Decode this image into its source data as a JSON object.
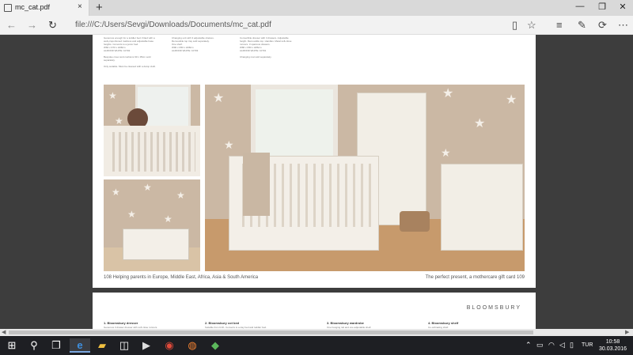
{
  "browser": {
    "tab_title": "mc_cat.pdf",
    "tab_close": "×",
    "new_tab": "+",
    "url": "file:///C:/Users/Sevgi/Downloads/Documents/mc_cat.pdf",
    "window": {
      "minimize": "—",
      "maximize": "❐",
      "close": "✕"
    }
  },
  "pdf": {
    "page1": {
      "col1_text": "Generous enough for a toddler bed. Fitted with a\nwell-proportioned mattress and adjustable base\nheights. Converts to a junior bed.\nW84 x D70 x H98cm\nALMOND WHITE: 10702\n\nBespoke cover and cushions 90 x 35cm sold\nseparately.\n\nOnly suitable. Must be cleaned with a damp cloth.",
      "col2_text": "Changing unit with 3 adjustable shelves.\nRemovable top tray sold separately.\nOne shelf.\nW90 x D50 x H98cm\nALMOND WHITE: 10703",
      "col3_text": "Convertible dresser with 3 drawers. Adjustable\nheight. Removable top. Handles. Metal soft-close\nrunners. 3 spacious drawers.\nW86 x D50 x H86cm\nALMOND WHITE: 10701\n\nChanging mat sold separately.",
      "footer_left": "108    Helping parents in Europe, Middle East, Africa, Asia & South America",
      "footer_right": "The perfect present, a mothercare gift card    109"
    },
    "page2": {
      "brand": "BLOOMSBURY",
      "products": [
        {
          "name": "1. Bloomsbury dresser",
          "desc": "Generous 3 drawer dresser with soft close runners."
        },
        {
          "name": "2. Bloomsbury cot bed",
          "desc": "Suitable from birth. Converts to a day bed and toddler bed."
        },
        {
          "name": "3. Bloomsbury wardrobe",
          "desc": "One hanging rail and one adjustable shelf."
        },
        {
          "name": "4. Bloomsbury shelf",
          "desc": "Co-ordinating shelf."
        }
      ]
    }
  },
  "taskbar": {
    "search_icon": "⚲",
    "lang": "TUR",
    "time": "10:58",
    "date": "30.03.2016"
  },
  "colors": {
    "accent": "#7aa7e0",
    "taskbar": "#1e1f23"
  }
}
